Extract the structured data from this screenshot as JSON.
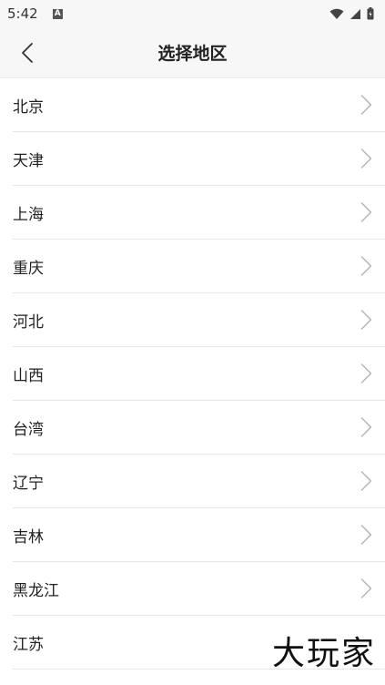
{
  "status_bar": {
    "time": "5:42",
    "notification_glyph": "A"
  },
  "header": {
    "title": "选择地区",
    "back_icon": "chevron-left-icon"
  },
  "regions": [
    {
      "label": "北京"
    },
    {
      "label": "天津"
    },
    {
      "label": "上海"
    },
    {
      "label": "重庆"
    },
    {
      "label": "河北"
    },
    {
      "label": "山西"
    },
    {
      "label": "台湾"
    },
    {
      "label": "辽宁"
    },
    {
      "label": "吉林"
    },
    {
      "label": "黑龙江"
    },
    {
      "label": "江苏"
    }
  ],
  "watermark": {
    "text": "大玩家"
  },
  "colors": {
    "header_bg": "#f7f7f7",
    "divider": "#e7e7e7",
    "chevron": "#b5b5b5",
    "text": "#222222"
  }
}
